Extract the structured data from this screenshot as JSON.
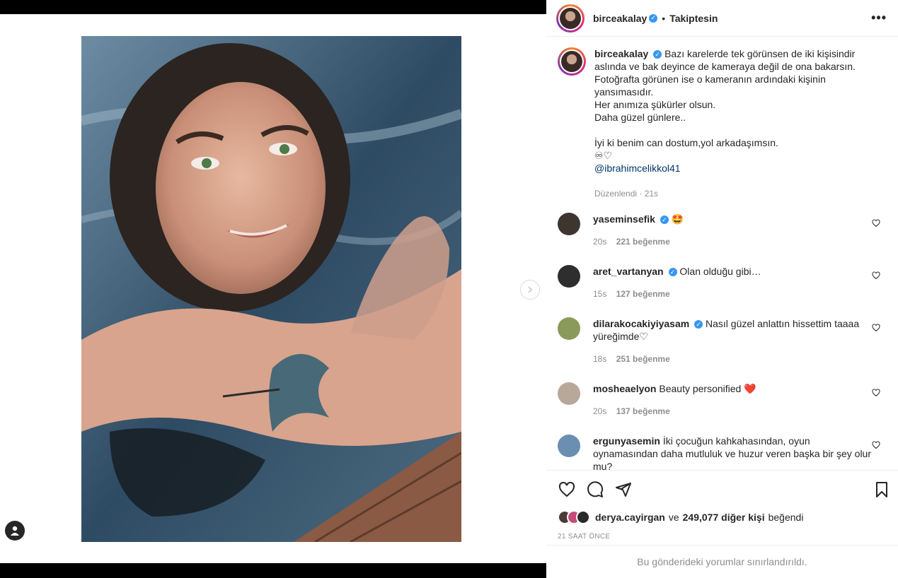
{
  "post": {
    "username": "birceakalay",
    "follow_status": "Takiptesin",
    "more_label": "•••",
    "caption_lines": [
      "Bazı karelerde tek görünsen de iki kişisindir",
      "aslında ve bak deyince de kameraya değil de ona bakarsın.",
      "Fotoğrafta görünen ise o kameranın ardındaki kişinin",
      "yansımasıdır.",
      "Her anımıza şükürler olsun.",
      "Daha güzel günlere..",
      "",
      "İyi ki benim can dostum,yol arkadaşımsın.",
      "♾♡"
    ],
    "mention": "@ibrahimcelikkol41",
    "edited": "Düzenlendi · 21s"
  },
  "comments": [
    {
      "username": "yaseminsefik",
      "verified": true,
      "text": "🤩",
      "time": "20s",
      "likes": "221 beğenme",
      "avatar_color": "#3d3530"
    },
    {
      "username": "aret_vartanyan",
      "verified": true,
      "text": "Olan olduğu gibi…",
      "time": "15s",
      "likes": "127 beğenme",
      "avatar_color": "#2e2e2e"
    },
    {
      "username": "dilarakocakiyiyasam",
      "verified": true,
      "text": "Nasıl güzel anlattın hissettim taaaa yüreğimde♡",
      "time": "18s",
      "likes": "251 beğenme",
      "avatar_color": "#8a9a5b"
    },
    {
      "username": "mosheaelyon",
      "verified": false,
      "text": "Beauty personified ❤️",
      "time": "20s",
      "likes": "137 beğenme",
      "avatar_color": "#b7a89a"
    },
    {
      "username": "ergunyasemin",
      "verified": false,
      "text": "İki çocuğun kahkahasından, oyun oynamasından daha mutluluk ve huzur veren başka bir şey olur mu?",
      "time": "",
      "likes": "",
      "avatar_color": "#6a8fb0"
    }
  ],
  "likes_summary": {
    "liker": "derya.cayirgan",
    "connector": "ve",
    "others": "249,077 diğer kişi",
    "suffix": "beğendi"
  },
  "time_ago": "21 SAAT ÖNCE",
  "restricted_notice": "Bu gönderideki yorumlar sınırlandırıldı."
}
